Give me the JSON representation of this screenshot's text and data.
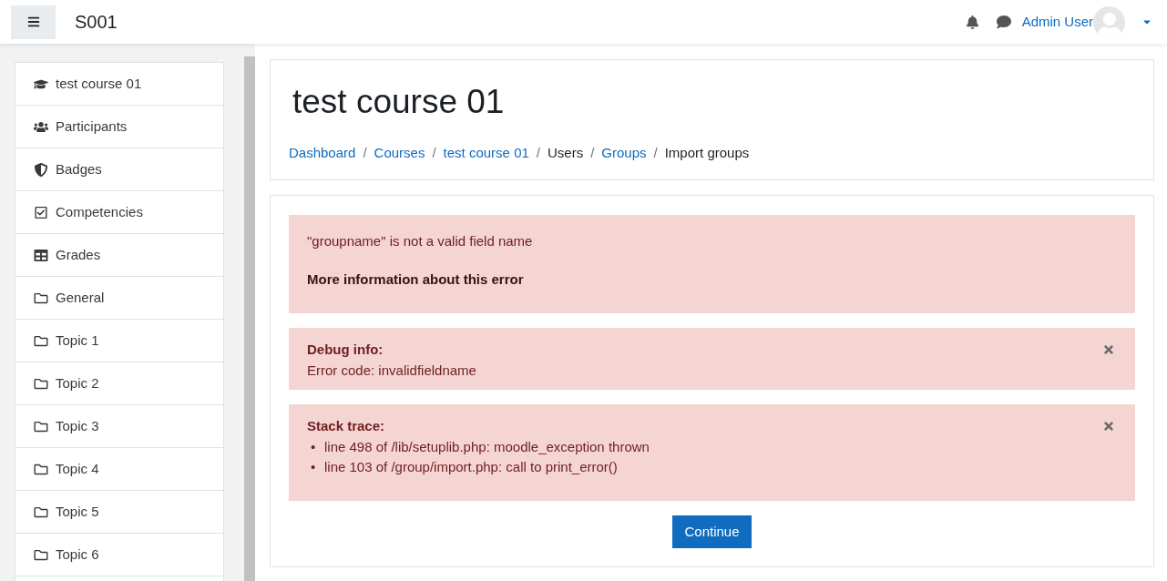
{
  "navbar": {
    "site_name": "S001",
    "user_name": "Admin User"
  },
  "sidebar": {
    "items": [
      {
        "label": "test course 01",
        "kind": "course"
      },
      {
        "label": "Participants",
        "kind": "participants"
      },
      {
        "label": "Badges",
        "kind": "badges"
      },
      {
        "label": "Competencies",
        "kind": "competencies"
      },
      {
        "label": "Grades",
        "kind": "grades"
      },
      {
        "label": "General",
        "kind": "section"
      },
      {
        "label": "Topic 1",
        "kind": "section"
      },
      {
        "label": "Topic 2",
        "kind": "section"
      },
      {
        "label": "Topic 3",
        "kind": "section"
      },
      {
        "label": "Topic 4",
        "kind": "section"
      },
      {
        "label": "Topic 5",
        "kind": "section"
      },
      {
        "label": "Topic 6",
        "kind": "section"
      }
    ]
  },
  "page_header": {
    "title": "test course 01",
    "separator": "/",
    "breadcrumb": [
      {
        "label": "Dashboard",
        "link": true
      },
      {
        "label": "Courses",
        "link": true
      },
      {
        "label": "test course 01",
        "link": true
      },
      {
        "label": "Users",
        "link": false
      },
      {
        "label": "Groups",
        "link": true
      },
      {
        "label": "Import groups",
        "link": false
      }
    ]
  },
  "error": {
    "message": "\"groupname\" is not a valid field name",
    "more_info": "More information about this error",
    "debug": {
      "title": "Debug info:",
      "text": "Error code: invalidfieldname",
      "close": true
    },
    "stack": {
      "title": "Stack trace:",
      "bullet": "•",
      "lines": [
        "line 498 of /lib/setuplib.php: moodle_exception thrown",
        "line 103 of /group/import.php: call to print_error()"
      ],
      "close": true
    },
    "button": "Continue"
  }
}
